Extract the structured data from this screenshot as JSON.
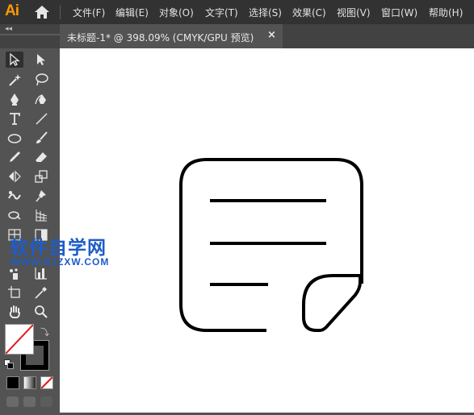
{
  "app": {
    "logo": "Ai"
  },
  "menu": {
    "items": [
      "文件(F)",
      "编辑(E)",
      "对象(O)",
      "文字(T)",
      "选择(S)",
      "效果(C)",
      "视图(V)",
      "窗口(W)",
      "帮助(H)"
    ]
  },
  "document_tab": {
    "title": "未标题-1* @ 398.09% (CMYK/GPU 预览)",
    "close_label": "×"
  },
  "toolbar": {
    "collapse_label": "◂◂",
    "tools": [
      "selection-tool",
      "direct-selection-tool",
      "magic-wand-tool",
      "lasso-tool",
      "pen-tool",
      "curvature-tool",
      "type-tool",
      "line-segment-tool",
      "ellipse-tool",
      "paintbrush-tool",
      "pencil-tool",
      "eraser-tool",
      "reflect-tool",
      "scale-tool",
      "puppet-warp-tool",
      "pin-tool",
      "shape-builder-tool",
      "perspective-grid-tool",
      "mesh-tool",
      "gradient-tool",
      "symbol-sprayer-tool",
      "column-graph-tool",
      "artboard-tool",
      "eyedropper-tool",
      "hand-tool",
      "zoom-tool"
    ],
    "fill_color": "#ffffff",
    "stroke_color": "#000000"
  },
  "watermark": {
    "main": "软件自学网",
    "sub": "WWW.RJZXW.COM",
    "color": "#1e5cc8"
  },
  "artwork": {
    "description_icon": "note-document-icon",
    "stroke_color": "#000000"
  }
}
